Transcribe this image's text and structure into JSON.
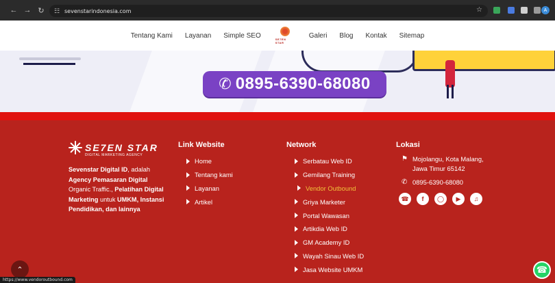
{
  "browser": {
    "url": "sevenstarindonesia.com",
    "avatar_letter": "A"
  },
  "nav": {
    "items_left": [
      "Tentang Kami",
      "Layanan",
      "Simple SEO"
    ],
    "logo_text": "SE7EN STAR",
    "items_right": [
      "Galeri",
      "Blog",
      "Kontak",
      "Sitemap"
    ]
  },
  "hero": {
    "phone": "0895-6390-68080"
  },
  "footer": {
    "brand_name": "SE7EN STAR",
    "brand_tagline": "DIGITAL MARKETING AGENCY",
    "desc_parts": [
      {
        "t": "Sevenstar Digital ID",
        "b": true
      },
      {
        "t": ", adalah ",
        "b": false
      },
      {
        "t": "Agency Pemasaran Digital",
        "b": true
      },
      {
        "t": " Organic Traffic., ",
        "b": false
      },
      {
        "t": "Pelatihan Digital Marketing",
        "b": true
      },
      {
        "t": " untuk ",
        "b": false
      },
      {
        "t": "UMKM, Instansi Pendidikan, dan lainnya",
        "b": true
      }
    ],
    "link_website": {
      "heading": "Link Website",
      "items": [
        "Home",
        "Tentang kami",
        "Layanan",
        "Artikel"
      ]
    },
    "network": {
      "heading": "Network",
      "items": [
        "Serbatau Web ID",
        "Gemilang Training",
        "Vendor Outbound",
        "Griya Marketer",
        "Portal Wawasan",
        "Artikdia Web ID",
        "GM Academy ID",
        "Wayah Sinau Web ID",
        "Jasa Website UMKM"
      ],
      "active_index": 2
    },
    "lokasi": {
      "heading": "Lokasi",
      "address": "Mojolangu, Kota Malang, Jawa Timur 65142",
      "phone": "0895-6390-68080",
      "socials": [
        "whatsapp-icon",
        "facebook-icon",
        "instagram-icon",
        "youtube-icon",
        "tiktok-icon"
      ]
    }
  },
  "status_bar": {
    "hover_url": "https://www.vendoroutbound.com"
  },
  "colors": {
    "footer_bg": "#b8231d",
    "accent_red": "#e0120f",
    "phone_btn": "#7a42c4",
    "active_link": "#f2c23a"
  }
}
